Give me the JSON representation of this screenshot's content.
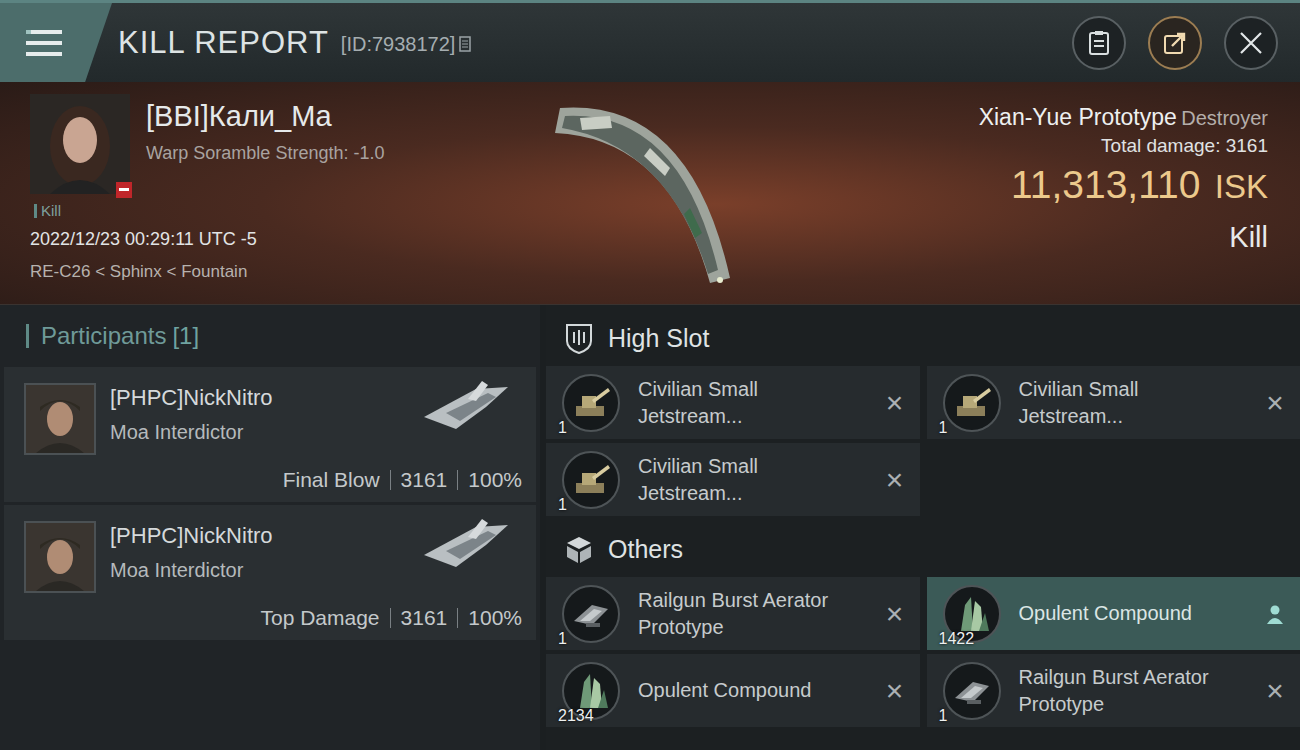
{
  "header": {
    "title": "KILL REPORT",
    "id": "[ID:7938172]"
  },
  "victim": {
    "name": "[BBI]Кали_Ма",
    "subtitle": "Warp Soramble Strength: -1.0",
    "tag": "Kill",
    "time": "2022/12/23 00:29:11 UTC -5",
    "location": "RE-C26 < Sphinx < Fountain"
  },
  "ship": {
    "name": "Xian-Yue Prototype",
    "class": "Destroyer",
    "damage_label": "Total damage:",
    "damage": "3161",
    "value": "11,313,110",
    "currency": "ISK",
    "result": "Kill"
  },
  "participants": {
    "title": "Participants",
    "count": "[1]",
    "items": [
      {
        "name": "[PHPC]NickNitro",
        "ship": "Moa Interdictor",
        "role": "Final Blow",
        "damage": "3161",
        "share": "100%"
      },
      {
        "name": "[PHPC]NickNitro",
        "ship": "Moa Interdictor",
        "role": "Top Damage",
        "damage": "3161",
        "share": "100%"
      }
    ]
  },
  "sections": [
    {
      "title": "High Slot",
      "kind": "slot",
      "items": [
        {
          "name": "Civilian Small Jetstream...",
          "qty": "1",
          "kind": "turret",
          "selected": false,
          "mark": "×"
        },
        {
          "name": "Civilian Small Jetstream...",
          "qty": "1",
          "kind": "turret",
          "selected": false,
          "mark": "×"
        },
        {
          "name": "Civilian Small Jetstream...",
          "qty": "1",
          "kind": "turret",
          "selected": false,
          "mark": "×"
        }
      ]
    },
    {
      "title": "Others",
      "kind": "cargo",
      "items": [
        {
          "name": "Railgun Burst Aerator Prototype",
          "qty": "1",
          "kind": "module",
          "selected": false,
          "mark": "×"
        },
        {
          "name": "Opulent Compound",
          "qty": "1422",
          "kind": "material",
          "selected": true
        },
        {
          "name": "Opulent Compound",
          "qty": "2134",
          "kind": "material",
          "selected": false,
          "mark": "×"
        },
        {
          "name": "Railgun Burst Aerator Prototype",
          "qty": "1",
          "kind": "module",
          "selected": false,
          "mark": "×"
        }
      ]
    }
  ]
}
